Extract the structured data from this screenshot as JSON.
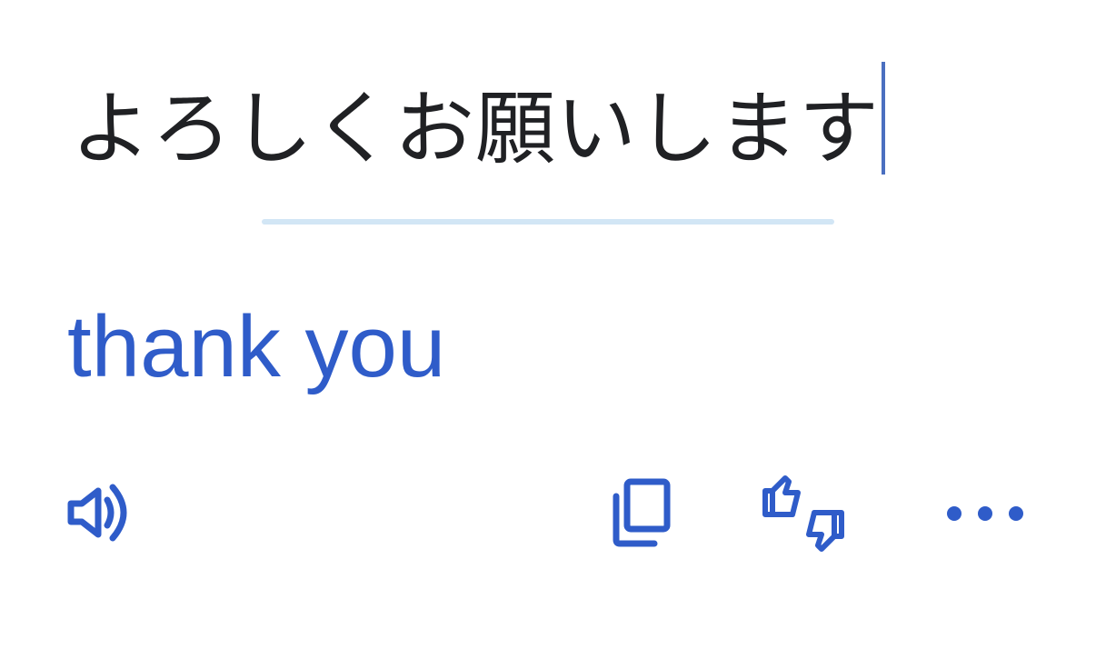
{
  "source": {
    "text": "よろしくお願いします"
  },
  "translation": {
    "text": "thank you"
  },
  "toolbar": {
    "speak_icon": "speaker-icon",
    "copy_icon": "copy-icon",
    "rate_icon": "thumbs-up-down-icon",
    "more_icon": "more-horizontal-icon"
  },
  "colors": {
    "accent": "#2f5cc9",
    "text": "#202124",
    "divider": "#d2e6f5",
    "caret": "#4a6fc0"
  }
}
